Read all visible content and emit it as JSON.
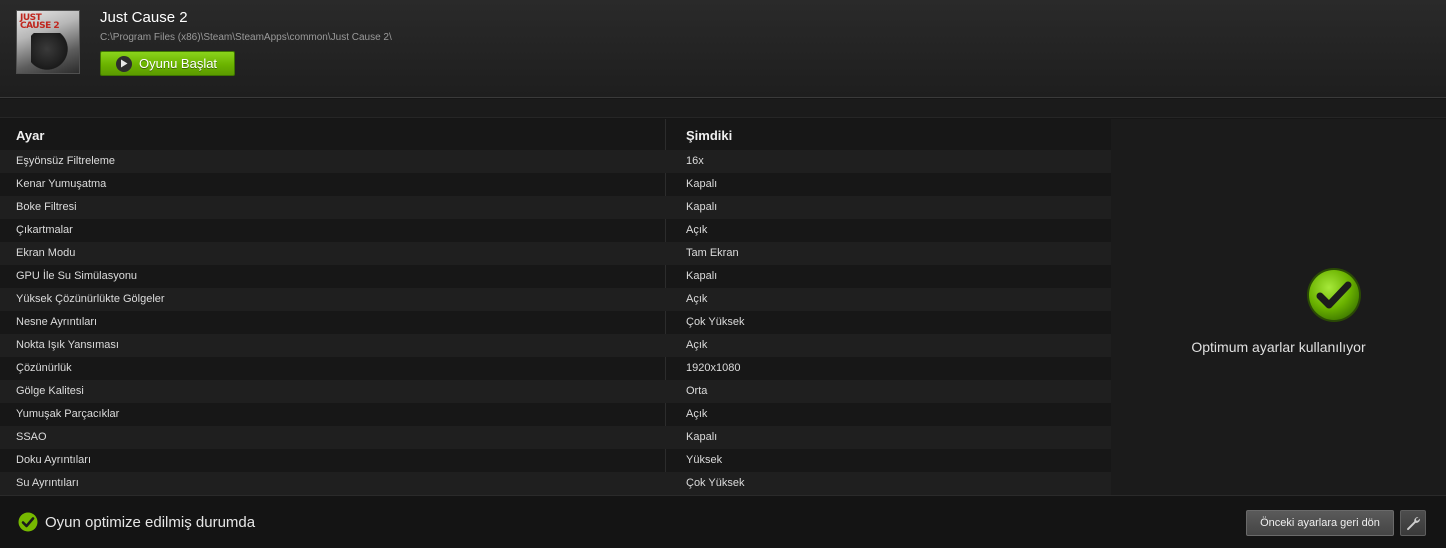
{
  "game": {
    "title": "Just Cause 2",
    "path": "C:\\Program Files (x86)\\Steam\\SteamApps\\common\\Just Cause 2\\",
    "cover_logo_line1": "JUST",
    "cover_logo_line2": "CAUSE 2",
    "launch_label": "Oyunu Başlat"
  },
  "table": {
    "col_setting": "Ayar",
    "col_current": "Şimdiki",
    "rows": [
      {
        "setting": "Eşyönsüz Filtreleme",
        "value": "16x"
      },
      {
        "setting": "Kenar Yumuşatma",
        "value": "Kapalı"
      },
      {
        "setting": "Boke Filtresi",
        "value": "Kapalı"
      },
      {
        "setting": "Çıkartmalar",
        "value": "Açık"
      },
      {
        "setting": "Ekran Modu",
        "value": "Tam Ekran"
      },
      {
        "setting": "GPU İle Su Simülasyonu",
        "value": "Kapalı"
      },
      {
        "setting": "Yüksek Çözünürlükte Gölgeler",
        "value": "Açık"
      },
      {
        "setting": "Nesne Ayrıntıları",
        "value": "Çok Yüksek"
      },
      {
        "setting": "Nokta Işık Yansıması",
        "value": "Açık"
      },
      {
        "setting": "Çözünürlük",
        "value": "1920x1080"
      },
      {
        "setting": "Gölge Kalitesi",
        "value": "Orta"
      },
      {
        "setting": "Yumuşak Parçacıklar",
        "value": "Açık"
      },
      {
        "setting": "SSAO",
        "value": "Kapalı"
      },
      {
        "setting": "Doku Ayrıntıları",
        "value": "Yüksek"
      },
      {
        "setting": "Su Ayrıntıları",
        "value": "Çok Yüksek"
      }
    ]
  },
  "panel": {
    "status_icon": "checkmark-circle-icon",
    "message": "Optimum ayarlar kullanılıyor"
  },
  "footer": {
    "status_icon": "checkmark-circle-icon",
    "status_text": "Oyun optimize edilmiş durumda",
    "revert_label": "Önceki ayarlara geri dön",
    "tools_icon": "wrench-icon"
  },
  "colors": {
    "accent_green": "#76b900",
    "background": "#161616",
    "row_alt": "#1f1f1f"
  }
}
